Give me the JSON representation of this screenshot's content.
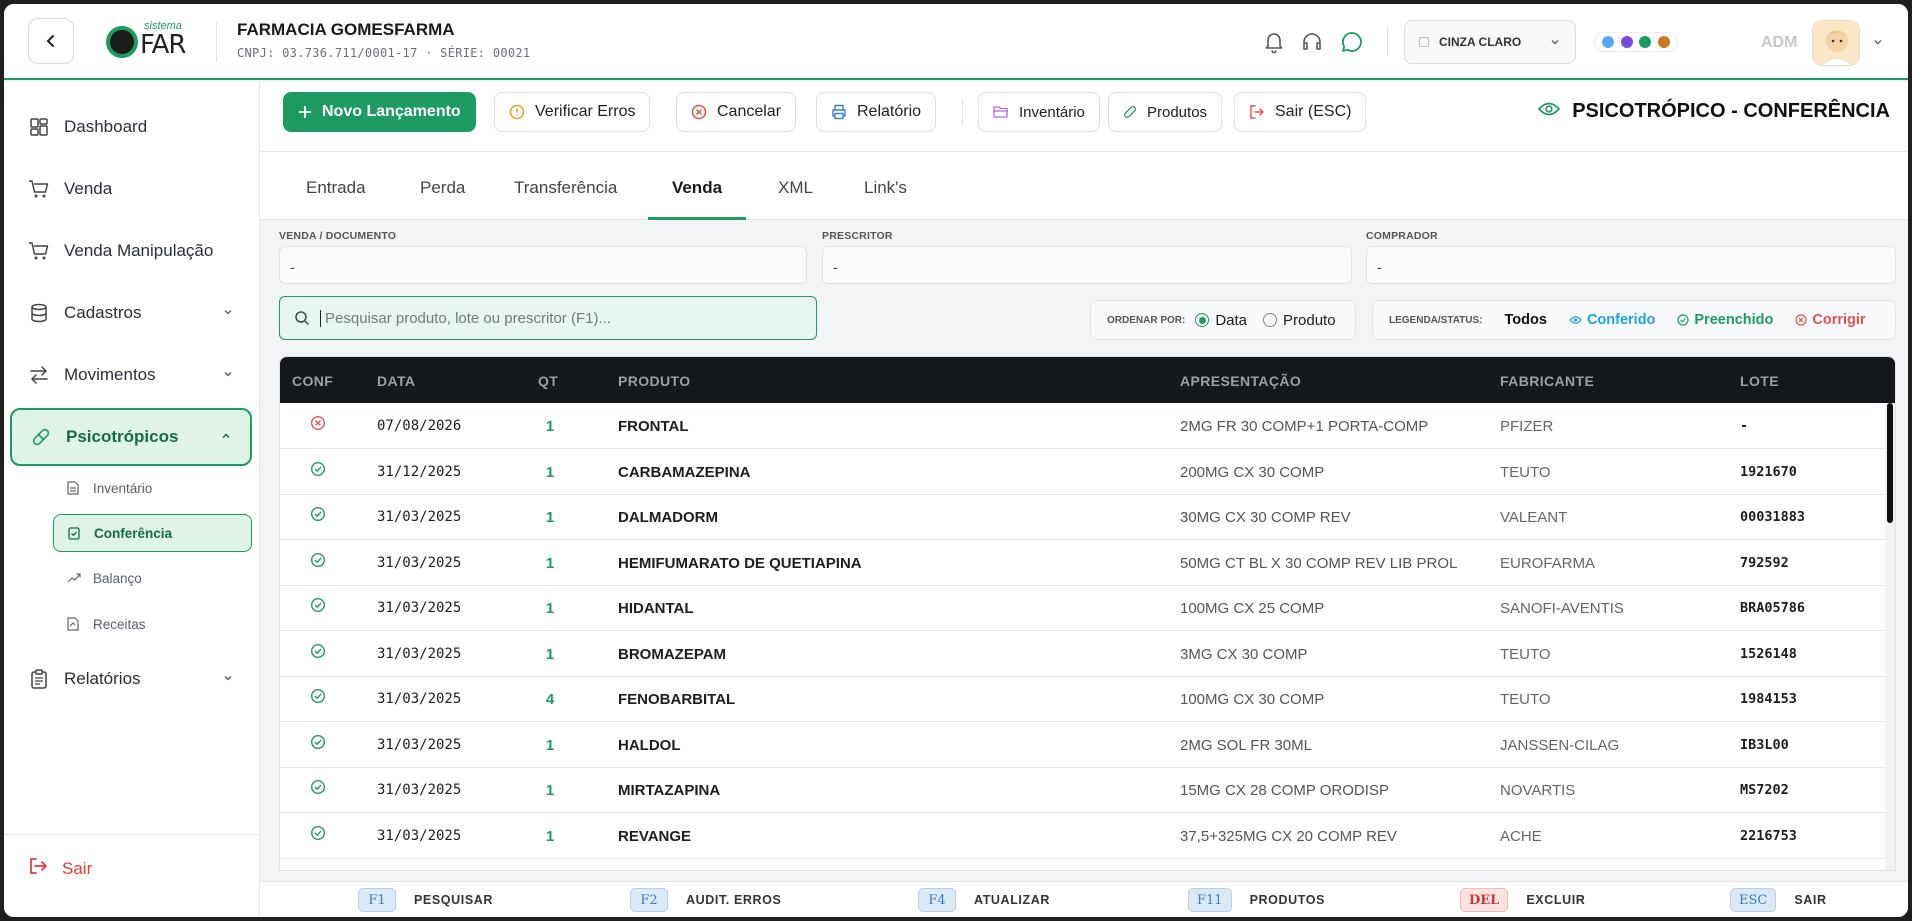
{
  "header": {
    "logo_small": "sistema",
    "logo_big": "FAR",
    "company_name": "FARMACIA GOMESFARMA",
    "company_sub": "CNPJ: 03.736.711/0001-17 · SÉRIE: 00021",
    "theme_label": "CINZA CLARO",
    "user_label": "ADM",
    "theme_dots": [
      "#5aa9f0",
      "#7b4be0",
      "#1e9a63",
      "#c97a22"
    ]
  },
  "sidebar": {
    "items": [
      {
        "label": "Dashboard",
        "icon": "dashboard-icon"
      },
      {
        "label": "Venda",
        "icon": "cart-icon"
      },
      {
        "label": "Venda Manipulação",
        "icon": "cart-icon"
      },
      {
        "label": "Cadastros",
        "icon": "database-icon"
      },
      {
        "label": "Movimentos",
        "icon": "arrows-icon"
      },
      {
        "label": "Psicotrópicos",
        "icon": "pill-icon"
      },
      {
        "label": "Relatórios",
        "icon": "clipboard-icon"
      }
    ],
    "sub_items": [
      {
        "label": "Inventário"
      },
      {
        "label": "Conferência"
      },
      {
        "label": "Balanço"
      },
      {
        "label": "Receitas"
      }
    ],
    "logout_label": "Sair"
  },
  "toolbar": {
    "new_label": "Novo Lançamento",
    "verify_label": "Verificar Erros",
    "cancel_label": "Cancelar",
    "report_label": "Relatório",
    "inventory_label": "Inventário",
    "products_label": "Produtos",
    "exit_label": "Sair (ESC)",
    "page_title": "PSICOTRÓPICO - CONFERÊNCIA"
  },
  "tabs": [
    "Entrada",
    "Perda",
    "Transferência",
    "Venda",
    "XML",
    "Link's"
  ],
  "fields": {
    "sale_label": "VENDA / DOCUMENTO",
    "sale_value": "-",
    "prescriber_label": "PRESCRITOR",
    "prescriber_value": "-",
    "buyer_label": "COMPRADOR",
    "buyer_value": "-"
  },
  "search": {
    "placeholder": "Pesquisar produto, lote ou prescritor (F1)..."
  },
  "order": {
    "label": "ORDENAR POR:",
    "option_date": "Data",
    "option_product": "Produto",
    "selected": "Data"
  },
  "legend": {
    "label": "LEGENDA/STATUS:",
    "all": "Todos",
    "checked": "Conferido",
    "filled": "Preenchido",
    "fix": "Corrigir",
    "colors": {
      "checked": "#1ea5d9",
      "filled": "#1e9a63",
      "fix": "#e05252"
    }
  },
  "table": {
    "headers": [
      "CONF",
      "DATA",
      "QT",
      "PRODUTO",
      "APRESENTAÇÃO",
      "FABRICANTE",
      "LOTE"
    ],
    "rows": [
      {
        "status": "error",
        "date": "07/08/2026",
        "qt": "1",
        "product": "FRONTAL",
        "presentation": "2MG FR 30 COMP+1 PORTA-COMP",
        "maker": "PFIZER",
        "lot": "-"
      },
      {
        "status": "ok",
        "date": "31/12/2025",
        "qt": "1",
        "product": "CARBAMAZEPINA",
        "presentation": "200MG CX 30 COMP",
        "maker": "TEUTO",
        "lot": "1921670"
      },
      {
        "status": "ok",
        "date": "31/03/2025",
        "qt": "1",
        "product": "DALMADORM",
        "presentation": "30MG CX 30 COMP REV",
        "maker": "VALEANT",
        "lot": "00031883"
      },
      {
        "status": "ok",
        "date": "31/03/2025",
        "qt": "1",
        "product": "HEMIFUMARATO DE QUETIAPINA",
        "presentation": "50MG CT BL X 30 COMP REV LIB PROL",
        "maker": "EUROFARMA",
        "lot": "792592"
      },
      {
        "status": "ok",
        "date": "31/03/2025",
        "qt": "1",
        "product": "HIDANTAL",
        "presentation": "100MG CX 25 COMP",
        "maker": "SANOFI-AVENTIS",
        "lot": "BRA05786"
      },
      {
        "status": "ok",
        "date": "31/03/2025",
        "qt": "1",
        "product": "BROMAZEPAM",
        "presentation": "3MG CX 30 COMP",
        "maker": "TEUTO",
        "lot": "1526148"
      },
      {
        "status": "ok",
        "date": "31/03/2025",
        "qt": "4",
        "product": "FENOBARBITAL",
        "presentation": "100MG CX 30 COMP",
        "maker": "TEUTO",
        "lot": "1984153"
      },
      {
        "status": "ok",
        "date": "31/03/2025",
        "qt": "1",
        "product": "HALDOL",
        "presentation": "2MG SOL FR 30ML",
        "maker": "JANSSEN-CILAG",
        "lot": "IB3L00"
      },
      {
        "status": "ok",
        "date": "31/03/2025",
        "qt": "1",
        "product": "MIRTAZAPINA",
        "presentation": "15MG CX 28 COMP ORODISP",
        "maker": "NOVARTIS",
        "lot": "MS7202"
      },
      {
        "status": "ok",
        "date": "31/03/2025",
        "qt": "1",
        "product": "REVANGE",
        "presentation": "37,5+325MG CX 20 COMP REV",
        "maker": "ACHE",
        "lot": "2216753"
      }
    ]
  },
  "footer": {
    "keys": [
      {
        "key": "F1",
        "label": "PESQUISAR"
      },
      {
        "key": "F2",
        "label": "AUDIT. ERROS"
      },
      {
        "key": "F4",
        "label": "ATUALIZAR"
      },
      {
        "key": "F11",
        "label": "PRODUTOS"
      },
      {
        "key": "DEL",
        "label": "EXCLUIR"
      },
      {
        "key": "ESC",
        "label": "SAIR"
      }
    ]
  }
}
